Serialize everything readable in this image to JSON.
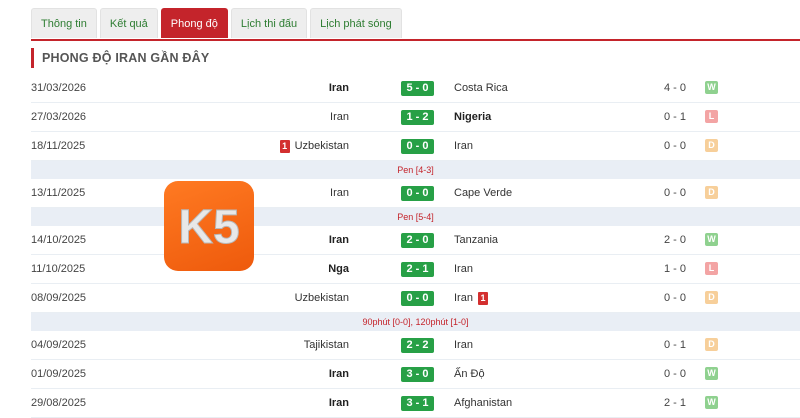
{
  "tabs": [
    {
      "label": "Thông tin",
      "active": false
    },
    {
      "label": "Kết quả",
      "active": false
    },
    {
      "label": "Phong độ",
      "active": true
    },
    {
      "label": "Lịch thi đấu",
      "active": false
    },
    {
      "label": "Lịch phát sóng",
      "active": false
    }
  ],
  "section_title": "PHONG ĐỘ IRAN GẦN ĐÂY",
  "logo": {
    "text": "K5"
  },
  "matches": [
    {
      "kind": "match",
      "date": "31/03/2026",
      "home": "Iran",
      "home_win": true,
      "home_card": null,
      "score": "5 - 0",
      "away": "Costa Rica",
      "away_win": false,
      "away_card": null,
      "ht": "4 - 0",
      "result": "W"
    },
    {
      "kind": "match",
      "date": "27/03/2026",
      "home": "Iran",
      "home_win": false,
      "home_card": null,
      "score": "1 - 2",
      "away": "Nigeria",
      "away_win": true,
      "away_card": null,
      "ht": "0 - 1",
      "result": "L"
    },
    {
      "kind": "match",
      "date": "18/11/2025",
      "home": "Uzbekistan",
      "home_win": false,
      "home_card": "1",
      "score": "0 - 0",
      "away": "Iran",
      "away_win": false,
      "away_card": null,
      "ht": "0 - 0",
      "result": "D"
    },
    {
      "kind": "note",
      "text": "Pen [4-3]"
    },
    {
      "kind": "match",
      "date": "13/11/2025",
      "home": "Iran",
      "home_win": false,
      "home_card": null,
      "score": "0 - 0",
      "away": "Cape Verde",
      "away_win": false,
      "away_card": null,
      "ht": "0 - 0",
      "result": "D"
    },
    {
      "kind": "note",
      "text": "Pen [5-4]"
    },
    {
      "kind": "match",
      "date": "14/10/2025",
      "home": "Iran",
      "home_win": true,
      "home_card": null,
      "score": "2 - 0",
      "away": "Tanzania",
      "away_win": false,
      "away_card": null,
      "ht": "2 - 0",
      "result": "W"
    },
    {
      "kind": "match",
      "date": "11/10/2025",
      "home": "Nga",
      "home_win": true,
      "home_card": null,
      "score": "2 - 1",
      "away": "Iran",
      "away_win": false,
      "away_card": null,
      "ht": "1 - 0",
      "result": "L"
    },
    {
      "kind": "match",
      "date": "08/09/2025",
      "home": "Uzbekistan",
      "home_win": false,
      "home_card": null,
      "score": "0 - 0",
      "away": "Iran",
      "away_win": false,
      "away_card": "1",
      "ht": "0 - 0",
      "result": "D"
    },
    {
      "kind": "note",
      "text": "90phút [0-0], 120phút [1-0]"
    },
    {
      "kind": "match",
      "date": "04/09/2025",
      "home": "Tajikistan",
      "home_win": false,
      "home_card": null,
      "score": "2 - 2",
      "away": "Iran",
      "away_win": false,
      "away_card": null,
      "ht": "0 - 1",
      "result": "D"
    },
    {
      "kind": "match",
      "date": "01/09/2025",
      "home": "Iran",
      "home_win": true,
      "home_card": null,
      "score": "3 - 0",
      "away": "Ấn Độ",
      "away_win": false,
      "away_card": null,
      "ht": "0 - 0",
      "result": "W"
    },
    {
      "kind": "match",
      "date": "29/08/2025",
      "home": "Iran",
      "home_win": true,
      "home_card": null,
      "score": "3 - 1",
      "away": "Afghanistan",
      "away_win": false,
      "away_card": null,
      "ht": "2 - 1",
      "result": "W"
    }
  ],
  "colors": {
    "accent": "#c4242b",
    "score_bg": "#27a046",
    "win": "#8fd18f",
    "loss": "#f3a4a4",
    "draw": "#f7cf9a",
    "logo": "#f26a12"
  }
}
